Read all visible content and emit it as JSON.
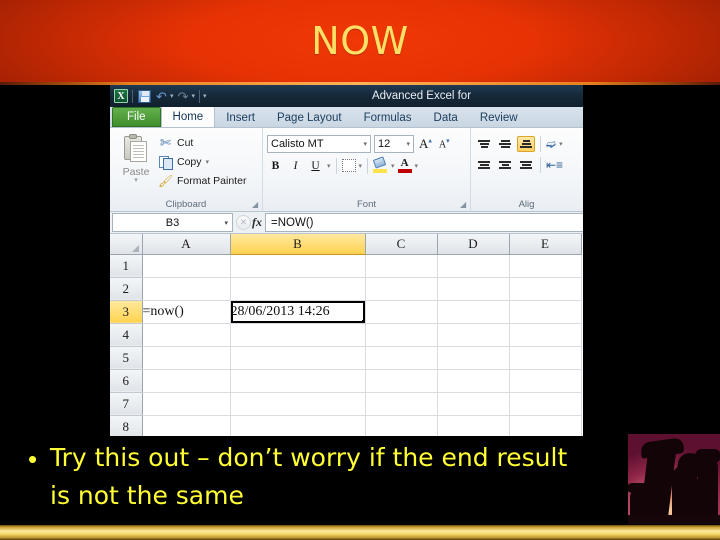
{
  "slide": {
    "title": "NOW",
    "bullet_marker": "•",
    "bullet_line1": "Try this out – don’t worry if the end result",
    "bullet_line2": "is not the same",
    "title_color": "#ffe066",
    "banner_color": "#e63204",
    "bullet_color": "#ffff33",
    "gold_bar_color": "#ffeb9c",
    "image_alt": "chess-pieces-silhouette"
  },
  "excel": {
    "window_title": "Advanced Excel for",
    "quick_access": [
      {
        "name": "excel-logo",
        "glyph": "X"
      },
      {
        "name": "save-icon",
        "glyph": "💾"
      },
      {
        "name": "undo-icon",
        "glyph": "↶"
      },
      {
        "name": "redo-icon",
        "glyph": "↷"
      },
      {
        "name": "customize-qat-icon",
        "glyph": "▾"
      }
    ],
    "tabs": [
      {
        "label": "File",
        "active": false,
        "style": "file"
      },
      {
        "label": "Home",
        "active": true,
        "style": "normal"
      },
      {
        "label": "Insert",
        "active": false,
        "style": "normal"
      },
      {
        "label": "Page Layout",
        "active": false,
        "style": "normal"
      },
      {
        "label": "Formulas",
        "active": false,
        "style": "normal"
      },
      {
        "label": "Data",
        "active": false,
        "style": "normal"
      },
      {
        "label": "Review",
        "active": false,
        "style": "normal"
      }
    ],
    "ribbon": {
      "clipboard": {
        "group_label": "Clipboard",
        "paste_label": "Paste",
        "items": [
          {
            "label": "Cut",
            "has_caret": false
          },
          {
            "label": "Copy",
            "has_caret": true
          },
          {
            "label": "Format Painter",
            "has_caret": false
          }
        ]
      },
      "font": {
        "group_label": "Font",
        "font_name": "Calisto MT",
        "font_size": "12",
        "grow_font_label": "A",
        "shrink_font_label": "A",
        "bold_label": "B",
        "italic_label": "I",
        "underline_label": "U",
        "font_color_label": "A",
        "font_color": "#c00000",
        "fill_color": "#ffe14d"
      },
      "alignment": {
        "group_label": "Alig",
        "active_button": "bottom-align",
        "wrap_text_icon": "»",
        "indent_icon": "≡"
      }
    },
    "formula_bar": {
      "name_box": "B3",
      "formula": "=NOW()",
      "fx_label": "fx",
      "cancel_label": "✕",
      "enter_label": "✓"
    },
    "sheet": {
      "columns": [
        "A",
        "B",
        "C",
        "D",
        "E"
      ],
      "selected_column": "B",
      "rows": [
        "1",
        "2",
        "3",
        "4",
        "5",
        "6",
        "7",
        "8"
      ],
      "selected_row": "3",
      "selected_cell": "B3",
      "cells": {
        "A3": "=now()",
        "B3": "28/06/2013 14:26"
      }
    }
  }
}
